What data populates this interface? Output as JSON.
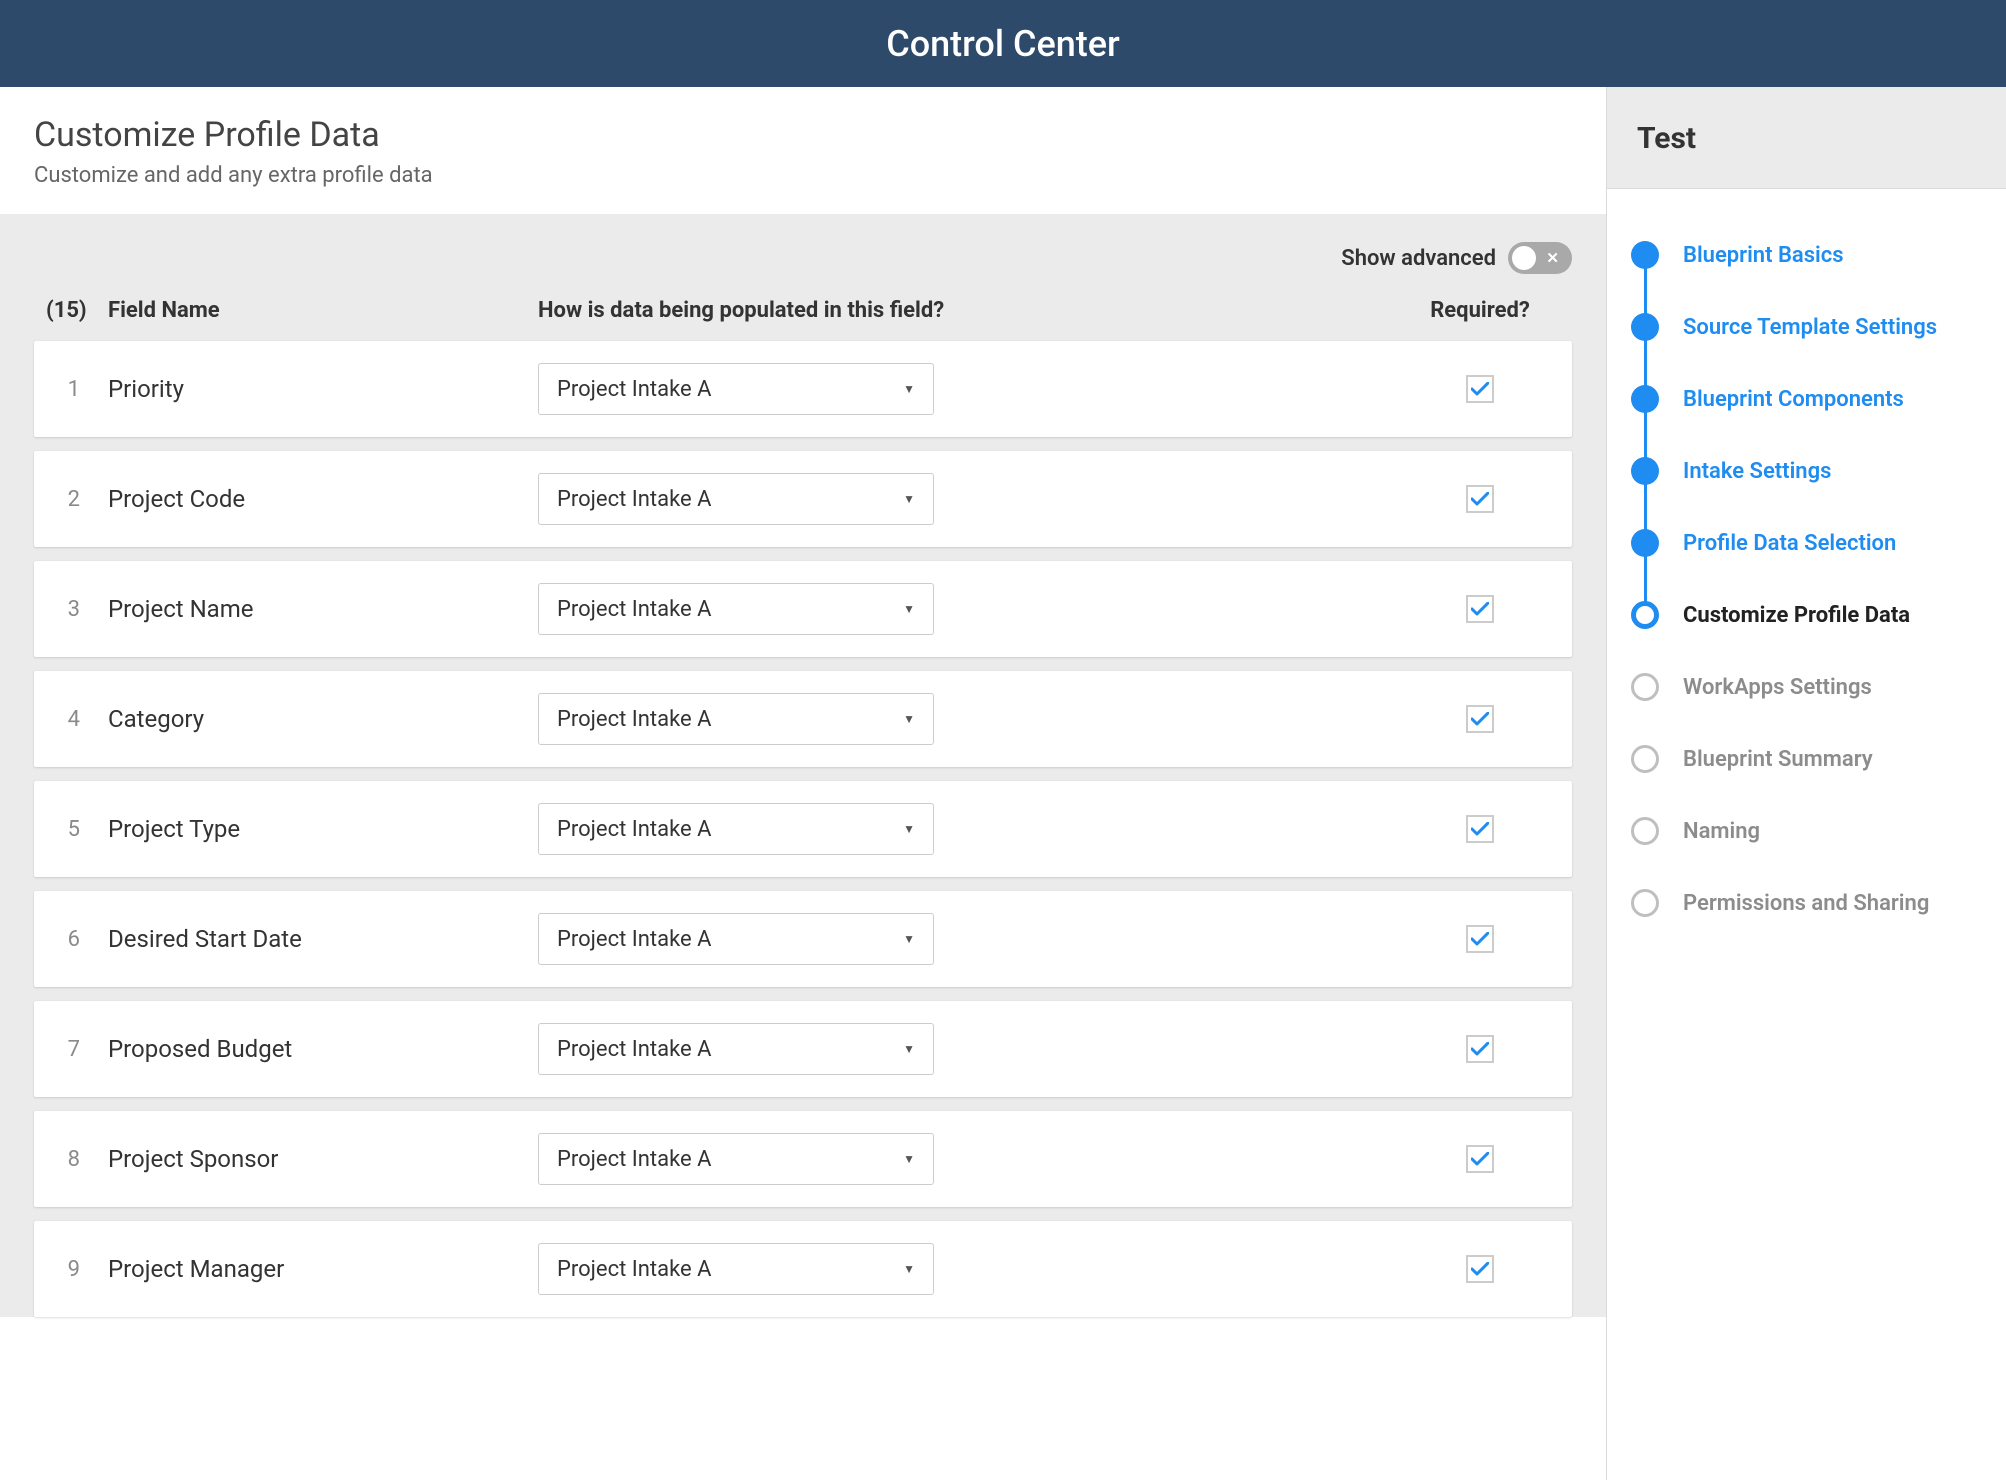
{
  "header": {
    "title": "Control Center"
  },
  "page": {
    "title": "Customize Profile Data",
    "subtitle": "Customize and add any extra profile data"
  },
  "advanced": {
    "label": "Show advanced",
    "on": false
  },
  "columns": {
    "count_label": "(15)",
    "name": "Field Name",
    "populate": "How is data being populated in this field?",
    "required": "Required?"
  },
  "fields": [
    {
      "num": 1,
      "name": "Priority",
      "populate": "Project Intake A",
      "required": true
    },
    {
      "num": 2,
      "name": "Project Code",
      "populate": "Project Intake A",
      "required": true
    },
    {
      "num": 3,
      "name": "Project Name",
      "populate": "Project Intake A",
      "required": true
    },
    {
      "num": 4,
      "name": "Category",
      "populate": "Project Intake A",
      "required": true
    },
    {
      "num": 5,
      "name": "Project Type",
      "populate": "Project Intake A",
      "required": true
    },
    {
      "num": 6,
      "name": "Desired Start Date",
      "populate": "Project Intake A",
      "required": true
    },
    {
      "num": 7,
      "name": "Proposed Budget",
      "populate": "Project Intake A",
      "required": true
    },
    {
      "num": 8,
      "name": "Project Sponsor",
      "populate": "Project Intake A",
      "required": true
    },
    {
      "num": 9,
      "name": "Project Manager",
      "populate": "Project Intake A",
      "required": true
    }
  ],
  "sidebar": {
    "title": "Test",
    "steps": [
      {
        "label": "Blueprint Basics",
        "state": "complete"
      },
      {
        "label": "Source Template Settings",
        "state": "complete"
      },
      {
        "label": "Blueprint Components",
        "state": "complete"
      },
      {
        "label": "Intake Settings",
        "state": "complete"
      },
      {
        "label": "Profile Data Selection",
        "state": "complete"
      },
      {
        "label": "Customize Profile Data",
        "state": "current"
      },
      {
        "label": "WorkApps Settings",
        "state": "upcoming"
      },
      {
        "label": "Blueprint Summary",
        "state": "upcoming"
      },
      {
        "label": "Naming",
        "state": "upcoming"
      },
      {
        "label": "Permissions and Sharing",
        "state": "upcoming"
      }
    ]
  }
}
